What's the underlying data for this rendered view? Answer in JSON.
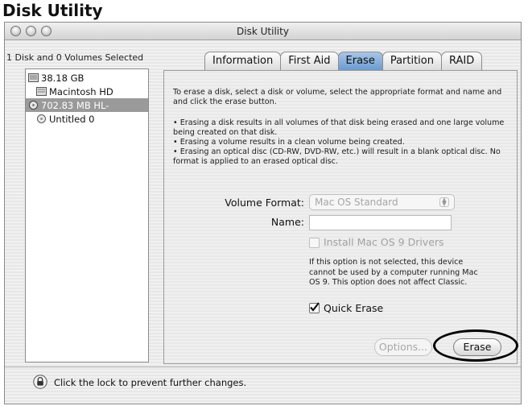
{
  "page": {
    "heading": "Disk Utility"
  },
  "window": {
    "title": "Disk Utility"
  },
  "sidebar": {
    "selection_summary": "1 Disk and 0 Volumes Selected",
    "items": [
      {
        "label": "38.18 GB",
        "icon": "hard-disk-icon",
        "indent": 0,
        "selected": false
      },
      {
        "label": "Macintosh HD",
        "icon": "volume-icon",
        "indent": 1,
        "selected": false
      },
      {
        "label": "702.83 MB HL-",
        "icon": "optical-disc-icon",
        "indent": 0,
        "selected": true
      },
      {
        "label": "Untitled 0",
        "icon": "optical-volume-icon",
        "indent": 1,
        "selected": false
      }
    ]
  },
  "tabs": [
    {
      "label": "Information",
      "active": false
    },
    {
      "label": "First Aid",
      "active": false
    },
    {
      "label": "Erase",
      "active": true
    },
    {
      "label": "Partition",
      "active": false
    },
    {
      "label": "RAID",
      "active": false
    }
  ],
  "erase": {
    "intro": "To erase a disk, select a disk or volume, select the appropriate format and name and and click the erase button.",
    "bullets": [
      "• Erasing a disk results in all volumes of that disk being erased and one large volume being created on that disk.",
      "• Erasing a volume results in a clean volume being created.",
      "• Erasing an optical disc (CD-RW, DVD-RW, etc.) will result in a blank optical disc. No format is applied to an erased optical disc."
    ],
    "volume_format_label": "Volume Format:",
    "volume_format_value": "Mac OS Standard",
    "name_label": "Name:",
    "name_value": "",
    "install_drivers_label": "Install Mac OS 9 Drivers",
    "install_drivers_checked": false,
    "install_drivers_enabled": false,
    "install_drivers_note": "If this option is not selected, this device cannot be used by a computer running Mac OS 9.  This option does not affect Classic.",
    "quick_erase_label": "Quick Erase",
    "quick_erase_checked": true,
    "options_button": "Options...",
    "erase_button": "Erase"
  },
  "footer": {
    "lock_text": "Click the lock to prevent further changes."
  }
}
